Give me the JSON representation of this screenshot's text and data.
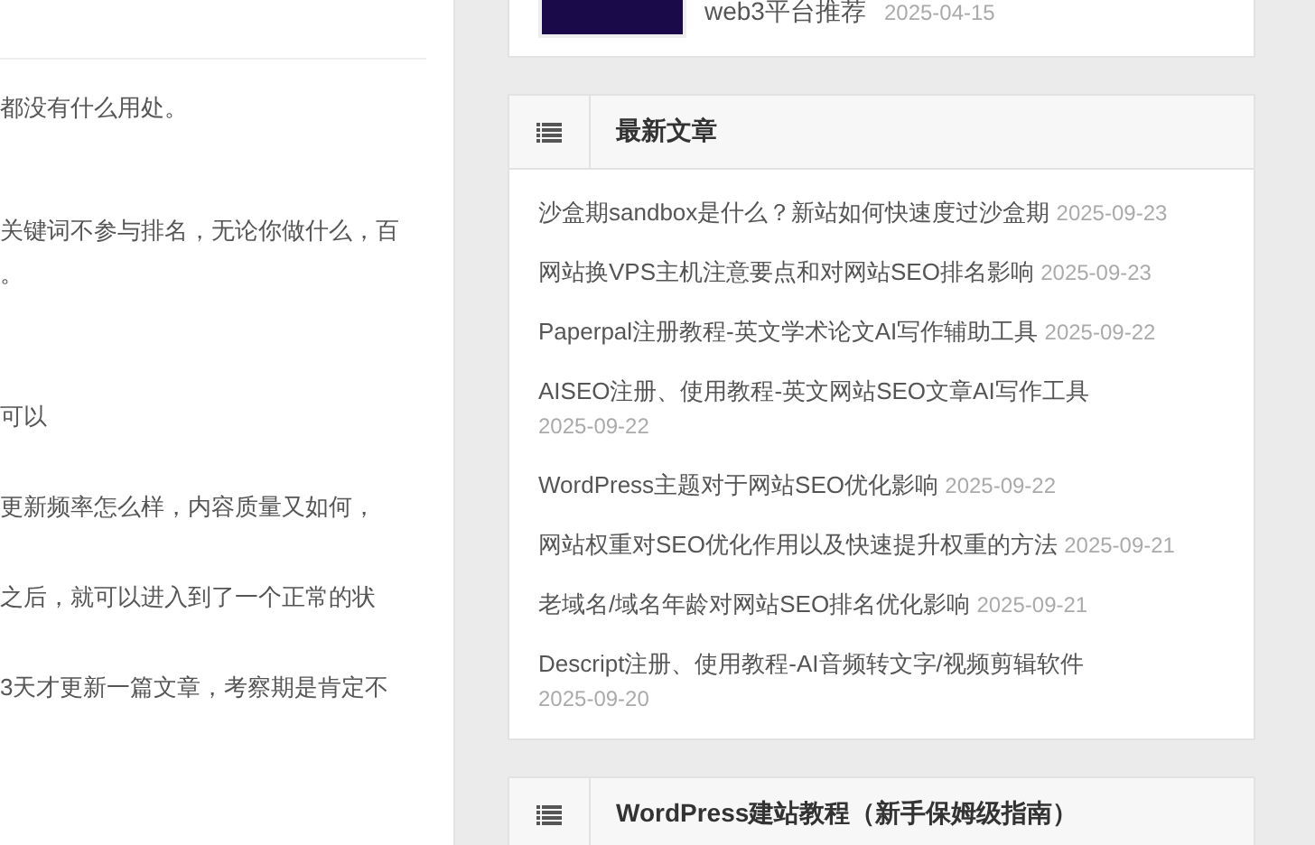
{
  "article": {
    "paragraphs": [
      "都没有什么用处。",
      "关键词不参与排名，无论你做什么，百",
      "。",
      "可以",
      "更新频率怎么样，内容质量又如何，",
      "之后，就可以进入到了一个正常的状",
      "3天才更新一篇文章，考察期是肯定不"
    ]
  },
  "sidebar": {
    "top_post": {
      "title": "web3平台推荐",
      "date": "2025-04-15"
    },
    "widgets": [
      {
        "title": "最新文章",
        "posts": [
          {
            "title": "沙盒期sandbox是什么？新站如何快速度过沙盒期",
            "date": "2025-09-23"
          },
          {
            "title": "网站换VPS主机注意要点和对网站SEO排名影响",
            "date": "2025-09-23"
          },
          {
            "title": "Paperpal注册教程-英文学术论文AI写作辅助工具",
            "date": "2025-09-22"
          },
          {
            "title": "AISEO注册、使用教程-英文网站SEO文章AI写作工具",
            "date": "2025-09-22"
          },
          {
            "title": "WordPress主题对于网站SEO优化影响",
            "date": "2025-09-22"
          },
          {
            "title": "网站权重对SEO优化作用以及快速提升权重的方法",
            "date": "2025-09-21"
          },
          {
            "title": "老域名/域名年龄对网站SEO排名优化影响",
            "date": "2025-09-21"
          },
          {
            "title": "Descript注册、使用教程-AI音频转文字/视频剪辑软件",
            "date": "2025-09-20"
          }
        ]
      },
      {
        "title": "WordPress建站教程（新手保姆级指南）"
      }
    ]
  }
}
